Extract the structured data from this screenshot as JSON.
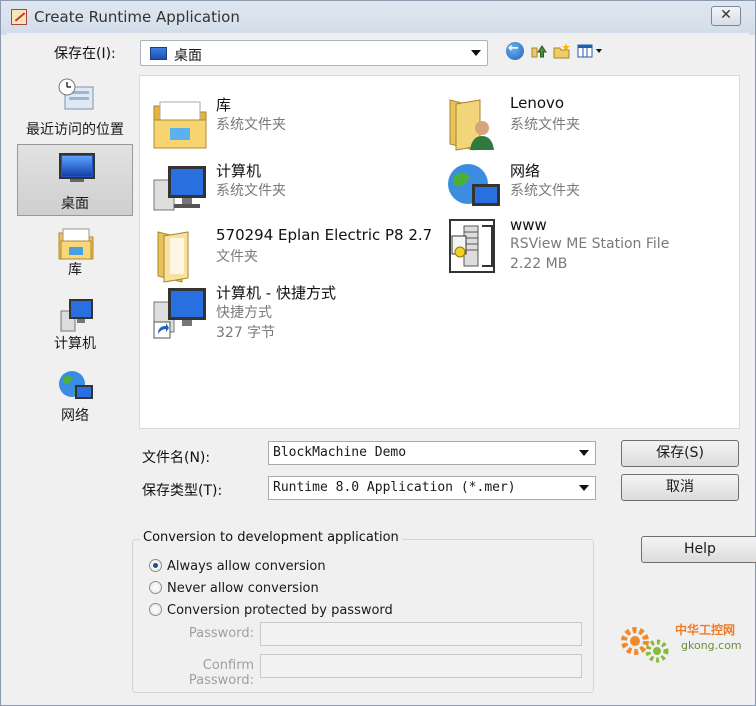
{
  "window": {
    "title": "Create Runtime Application",
    "close_label": "✕"
  },
  "lookin": {
    "label": "保存在(I):",
    "value": "桌面"
  },
  "toolbar": {
    "back": "back-icon",
    "up": "up-folder-icon",
    "new_folder": "new-folder-icon",
    "views": "views-menu-icon"
  },
  "places": [
    {
      "label": "最近访问的位置",
      "icon": "recent-places-icon"
    },
    {
      "label": "桌面",
      "icon": "desktop-icon",
      "selected": true
    },
    {
      "label": "库",
      "icon": "libraries-icon"
    },
    {
      "label": "计算机",
      "icon": "computer-icon"
    },
    {
      "label": "网络",
      "icon": "network-icon"
    }
  ],
  "files": [
    {
      "name": "库",
      "type": "系统文件夹",
      "detail": "",
      "icon": "libraries-folder-icon"
    },
    {
      "name": "Lenovo",
      "type": "系统文件夹",
      "detail": "",
      "icon": "user-folder-icon"
    },
    {
      "name": "计算机",
      "type": "系统文件夹",
      "detail": "",
      "icon": "computer-icon"
    },
    {
      "name": "网络",
      "type": "系统文件夹",
      "detail": "",
      "icon": "network-icon"
    },
    {
      "name": "570294 Eplan Electric P8 2.7",
      "type": "文件夹",
      "detail": "",
      "icon": "folder-icon"
    },
    {
      "name": "www",
      "type": "RSView ME Station File",
      "detail": "2.22 MB",
      "icon": "rsview-file-icon"
    },
    {
      "name": "计算机 - 快捷方式",
      "type": "快捷方式",
      "detail": "327 字节",
      "icon": "shortcut-icon"
    }
  ],
  "filename": {
    "label": "文件名(N):",
    "value": "BlockMachine Demo"
  },
  "filetype": {
    "label": "保存类型(T):",
    "value": "Runtime 8.0 Application (*.mer)"
  },
  "buttons": {
    "save": "保存(S)",
    "cancel": "取消",
    "help": "Help"
  },
  "conversion": {
    "title": "Conversion to development application",
    "options": [
      {
        "label": "Always allow conversion",
        "selected": true
      },
      {
        "label": "Never allow conversion",
        "selected": false
      },
      {
        "label": "Conversion protected by password",
        "selected": false
      }
    ],
    "password_label": "Password:",
    "confirm_label": "Confirm Password:"
  },
  "watermark": {
    "line1": "中华工控网",
    "line2": "gkong.com"
  }
}
